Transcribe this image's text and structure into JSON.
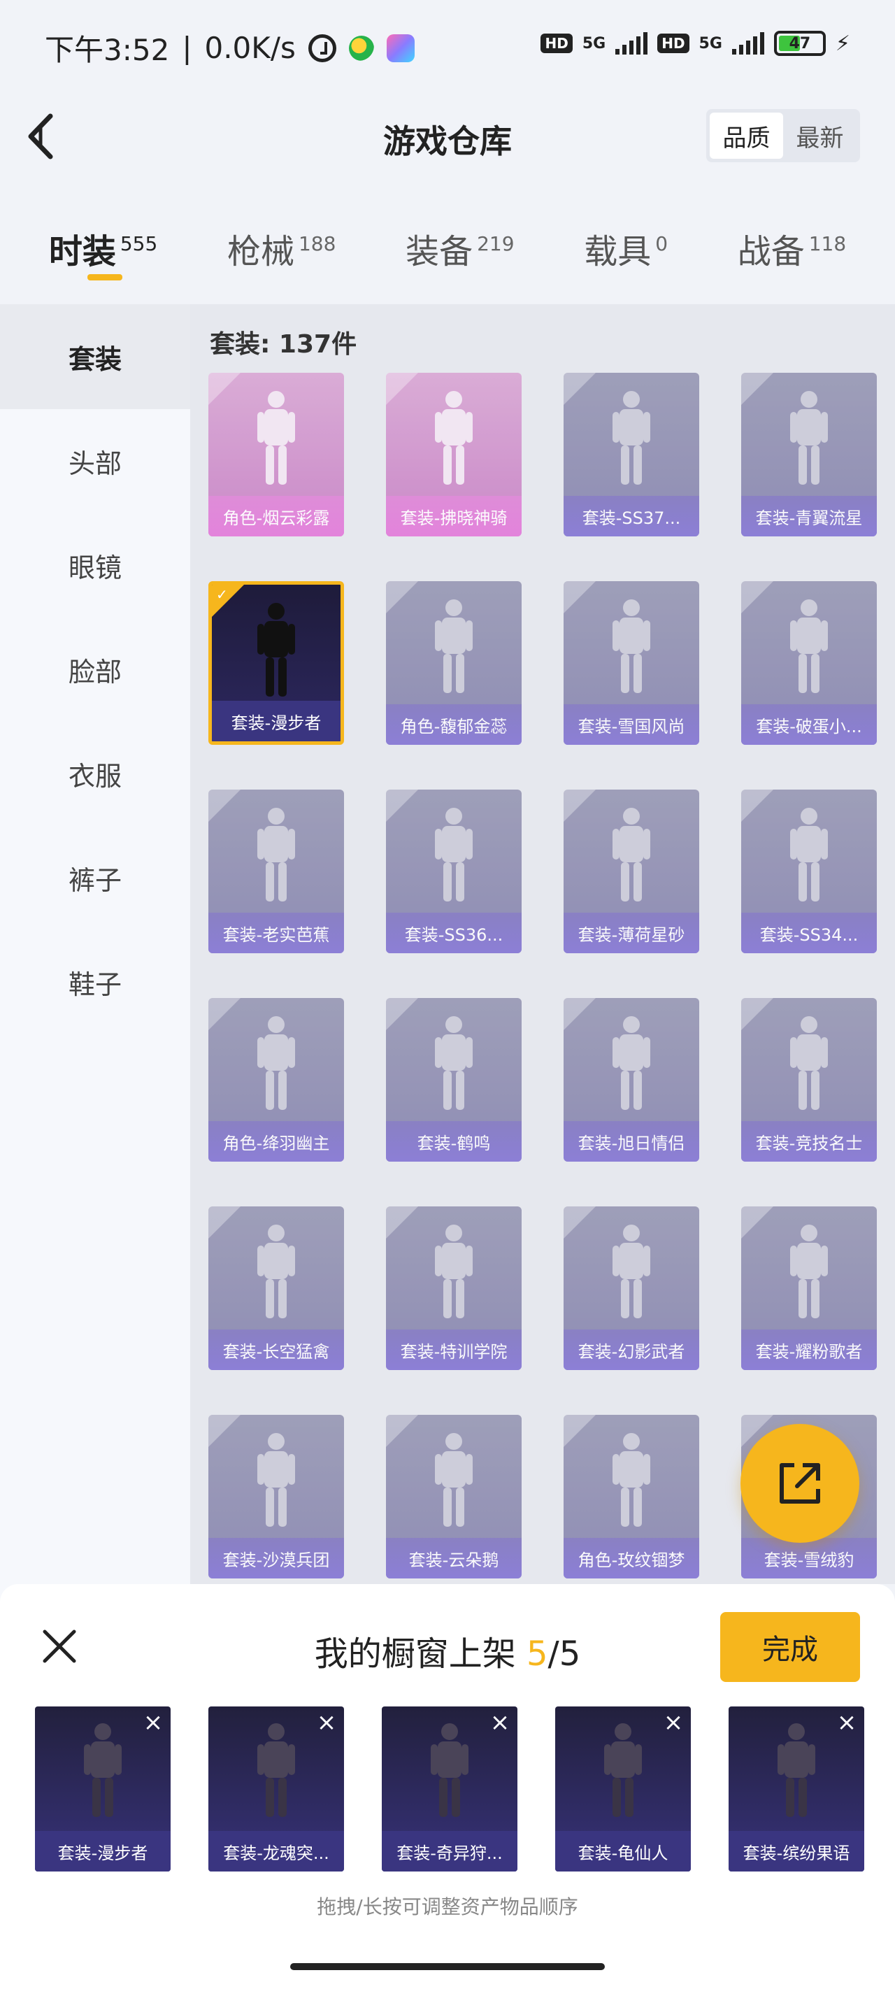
{
  "status_bar": {
    "time": "下午3:52",
    "speed": "0.0K/s",
    "hd1": "HD",
    "net1": "5G",
    "hd2": "HD",
    "net2": "5G",
    "battery": "47"
  },
  "header": {
    "title": "游戏仓库",
    "sort_options": [
      "品质",
      "最新"
    ],
    "active_sort": "品质"
  },
  "tabs": [
    {
      "label": "时装",
      "count": "555",
      "active": true
    },
    {
      "label": "枪械",
      "count": "188"
    },
    {
      "label": "装备",
      "count": "219"
    },
    {
      "label": "载具",
      "count": "0"
    },
    {
      "label": "战备",
      "count": "118"
    }
  ],
  "sidenav": [
    "套装",
    "头部",
    "眼镜",
    "脸部",
    "衣服",
    "裤子",
    "鞋子"
  ],
  "main": {
    "count_label": "套装: 137件",
    "items": [
      {
        "label": "角色-烟云彩露",
        "style": "pink"
      },
      {
        "label": "套装-拂晓神骑",
        "style": "pink"
      },
      {
        "label": "套装-SS37...",
        "style": "normal"
      },
      {
        "label": "套装-青翼流星",
        "style": "normal"
      },
      {
        "label": "套装-漫步者",
        "style": "selected"
      },
      {
        "label": "角色-馥郁金蕊",
        "style": "normal"
      },
      {
        "label": "套装-雪国风尚",
        "style": "normal"
      },
      {
        "label": "套装-破蛋小...",
        "style": "normal"
      },
      {
        "label": "套装-老实芭蕉",
        "style": "normal"
      },
      {
        "label": "套装-SS36...",
        "style": "normal"
      },
      {
        "label": "套装-薄荷星砂",
        "style": "normal"
      },
      {
        "label": "套装-SS34...",
        "style": "normal"
      },
      {
        "label": "角色-绛羽幽主",
        "style": "normal"
      },
      {
        "label": "套装-鹤鸣",
        "style": "normal"
      },
      {
        "label": "套装-旭日情侣",
        "style": "normal"
      },
      {
        "label": "套装-竞技名士",
        "style": "normal"
      },
      {
        "label": "套装-长空猛禽",
        "style": "normal"
      },
      {
        "label": "套装-特训学院",
        "style": "normal"
      },
      {
        "label": "套装-幻影武者",
        "style": "normal"
      },
      {
        "label": "套装-耀粉歌者",
        "style": "normal"
      },
      {
        "label": "套装-沙漠兵团",
        "style": "normal"
      },
      {
        "label": "套装-云朵鹅",
        "style": "normal"
      },
      {
        "label": "角色-玫纹锢梦",
        "style": "normal"
      },
      {
        "label": "套装-雪绒豹",
        "style": "normal"
      }
    ]
  },
  "panel": {
    "title": "我的橱窗上架 ",
    "count_current": "5",
    "count_sep": "/5",
    "done_label": "完成",
    "shelf": [
      "套装-漫步者",
      "套装-龙魂突...",
      "套装-奇异狩...",
      "套装-龟仙人",
      "套装-缤纷果语"
    ],
    "hint": "拖拽/长按可调整资产物品顺序"
  },
  "colors": {
    "accent": "#f6b61d",
    "card_purple": "#7d7aa8",
    "card_pink": "#c77fc4",
    "card_dark": "#2d2860"
  }
}
